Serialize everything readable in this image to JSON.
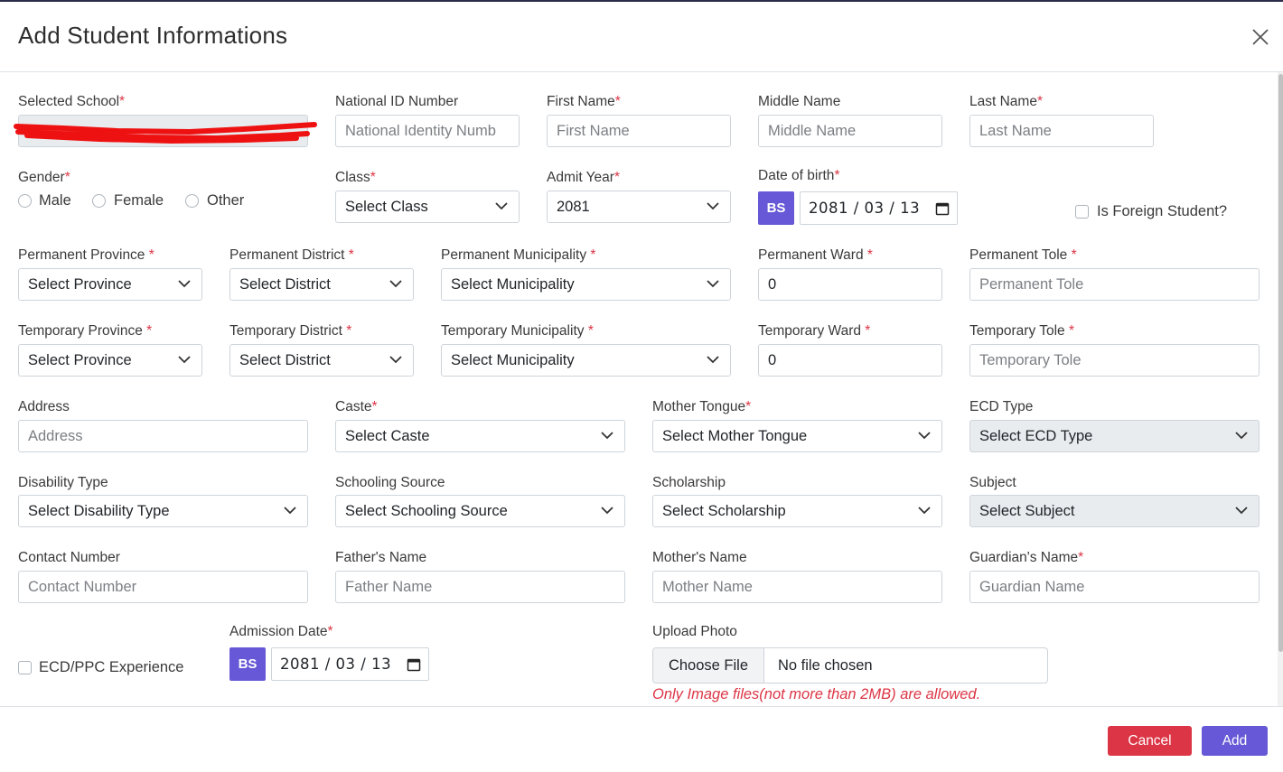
{
  "modal": {
    "title": "Add Student Informations"
  },
  "row1": {
    "selected_school_label": "Selected School",
    "national_id_label": "National ID Number",
    "national_id_placeholder": "National Identity Numb",
    "first_name_label": "First Name",
    "first_name_placeholder": "First Name",
    "middle_name_label": "Middle Name",
    "middle_name_placeholder": "Middle Name",
    "last_name_label": "Last Name",
    "last_name_placeholder": "Last Name"
  },
  "row2": {
    "gender_label": "Gender",
    "gender_options": [
      "Male",
      "Female",
      "Other"
    ],
    "class_label": "Class",
    "class_value": "Select Class",
    "admit_year_label": "Admit Year",
    "admit_year_value": "2081",
    "dob_label": "Date of birth",
    "dob_calendar": "BS",
    "dob_value": "2081 / 03 / 13",
    "foreign_label": "Is Foreign Student?"
  },
  "permanent": {
    "province_label": "Permanent Province",
    "province_value": "Select Province",
    "district_label": "Permanent District",
    "district_value": "Select District",
    "municipality_label": "Permanent Municipality",
    "municipality_value": "Select Municipality",
    "ward_label": "Permanent Ward",
    "ward_value": "0",
    "tole_label": "Permanent Tole",
    "tole_placeholder": "Permanent Tole"
  },
  "temporary": {
    "province_label": "Temporary Province",
    "province_value": "Select Province",
    "district_label": "Temporary District",
    "district_value": "Select District",
    "municipality_label": "Temporary Municipality",
    "municipality_value": "Select Municipality",
    "ward_label": "Temporary Ward",
    "ward_value": "0",
    "tole_label": "Temporary Tole",
    "tole_placeholder": "Temporary Tole"
  },
  "row5": {
    "address_label": "Address",
    "address_placeholder": "Address",
    "caste_label": "Caste",
    "caste_value": "Select Caste",
    "mother_tongue_label": "Mother Tongue",
    "mother_tongue_value": "Select Mother Tongue",
    "ecd_type_label": "ECD Type",
    "ecd_type_value": "Select ECD Type"
  },
  "row6": {
    "disability_label": "Disability Type",
    "disability_value": "Select Disability Type",
    "schooling_label": "Schooling Source",
    "schooling_value": "Select Schooling Source",
    "scholarship_label": "Scholarship",
    "scholarship_value": "Select Scholarship",
    "subject_label": "Subject",
    "subject_value": "Select Subject"
  },
  "row7": {
    "contact_label": "Contact Number",
    "contact_placeholder": "Contact Number",
    "father_label": "Father's Name",
    "father_placeholder": "Father Name",
    "mother_label": "Mother's Name",
    "mother_placeholder": "Mother Name",
    "guardian_label": "Guardian's Name",
    "guardian_placeholder": "Guardian Name"
  },
  "row8": {
    "ecd_experience_label": "ECD/PPC Experience",
    "admission_label": "Admission Date",
    "admission_calendar": "BS",
    "admission_value": "2081 / 03 / 13",
    "upload_label": "Upload Photo",
    "choose_file_label": "Choose File",
    "no_file_text": "No file chosen",
    "upload_note": "Only Image files(not more than 2MB) are allowed."
  },
  "footer": {
    "cancel_label": "Cancel",
    "add_label": "Add"
  },
  "colors": {
    "accent": "#6658d6",
    "danger": "#dc3545",
    "required": "#dc3545",
    "redaction": "#ee1111"
  },
  "required_marker": "*"
}
